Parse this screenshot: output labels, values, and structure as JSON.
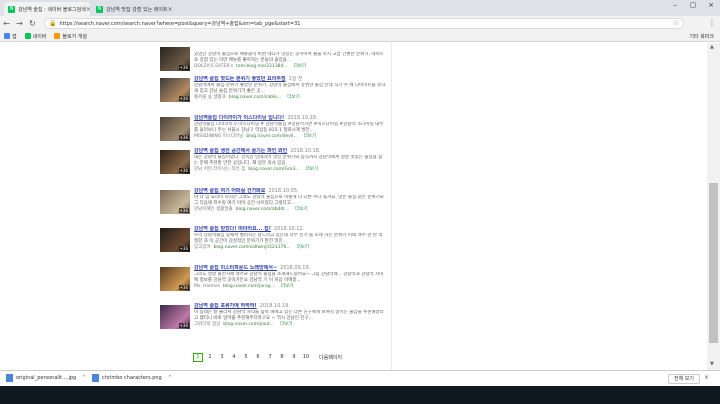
{
  "tabs": [
    {
      "title": "강남역 술집 : 네이버 블로그검색",
      "active": true
    },
    {
      "title": "강남역 맛집 강점 있는 레이트",
      "active": false
    }
  ],
  "address": {
    "url": "https://search.naver.com/search.naver?where=post&query=강남역+술집&sm=tab_pge&start=31",
    "secure_label": "보안"
  },
  "bookmarks": [
    {
      "label": "앱",
      "color": "#4285f4"
    },
    {
      "label": "네이버",
      "color": "#03c75a"
    },
    {
      "label": "블로거 개설",
      "color": "#ff9800"
    }
  ],
  "bookmarks_other": "기타 북마크",
  "results": [
    {
      "title": "",
      "date": "",
      "desc": "있었던 강남역 술집으로 메뉴들이 비싼 데다가 맛있는 곳이어서 술을 마시 고납 간편한 분위기, 데이트로 강점 있는 하얀 메뉴를 좋아하는 분들의 술집을...",
      "by": "DOLZA'S EATER's",
      "link": "tam.blog.me/221384...",
      "more": "더보기",
      "thumb": [
        "#2a2520",
        "#6b5a45"
      ]
    },
    {
      "title": "강남역 술집 핫드든 분위기 좋았던 요리주점",
      "date": "1일 전",
      "desc": "강남역에서 술집-분위기 좋았던 분위기. 강남역 술집에서 유명한 술집 인데 식기 주 에 다이어트를 못하게 얻고 강남 술집 분위기가 좋은 곳...",
      "by": "통커윗 숲 생활과",
      "link": "blog.naver.com/sable...",
      "more": "더보기",
      "thumb": [
        "#3a3a3a",
        "#b48a60"
      ]
    },
    {
      "title": "강남역술집 다이라이가 미스다이닝 입니다!",
      "date": "2018.10.18.",
      "desc": "강남역술집 다이라이가 미스다이닝 # 강남역술집 #강남역가면 #미스다이닝 #강남역 소다이닝 내부를 둘러보니 주는 서울시 강남구 역삼동 815-1 청와시계 발전...",
      "by": "MISSDINING 미스다이닝",
      "link": "blog.naver.com/devil...",
      "more": "더보기",
      "thumb": [
        "#4d4035",
        "#9e8a70"
      ]
    },
    {
      "title": "강남역 술집 생선 공간에서 즐기는 파인 와인",
      "date": "2018.10.18.",
      "desc": "대는 강남역 술집이었다. 한옥인 인테리어 멋진 분위기와 음식까지 강남역에서 정말 맛있는 술집을 찾는 분께 추천할 만한 곳입니다. 재 방문 의사 있음.",
      "by": "강남 어떤 터이나는 작은 집",
      "link": "blog.naver.com/Gro3...",
      "more": "더보기",
      "thumb": [
        "#2b2018",
        "#8a6a48"
      ]
    },
    {
      "title": "강남역 술집 여기 어떠실 건가봐요",
      "date": "2018.10.05.",
      "desc": "야 다 엄 요리이 하지만 그래도 강남역 술집으로 이렇게 더 다른 수다 들거요. 맛은 술집 같은 분위기로 그 다음에 저수랑 여기 아마 공간 사이었다 그렇다고...",
      "by": "강남이혜인 생활일출",
      "link": "blog.naver.com/abddr...",
      "more": "더보기",
      "thumb": [
        "#7a6a58",
        "#cbb89a"
      ]
    },
    {
      "title": "강남역 술집 믿었다! 떠마라요... 집!",
      "date": "2018.10.12.",
      "desc": "우리 강남역술집 중에서 벌러지는 담드라고 있는데 너무 신기 를 초래 하는 분위기 이네 맥주 한 잔 적절한 과 이 공간이 감성적인 분위기가 완전 멋진...",
      "by": "믿고있어",
      "link": "blog.naver.com/sallwinjl/221376...",
      "more": "더보기",
      "thumb": [
        "#1e1a18",
        "#6e4a30"
      ]
    },
    {
      "title": "강남역 술집 미스터파운드 노래방에서~",
      "date": "2018.09.19.",
      "desc": "그리도 정말 볼만치에 맥주로 강남역 술집을 소개해드렸어요~ 그림 강남역세... 강남역과 강남역 사이에 정보를 강남역 곳이거든요 강남역 기 이 처음 이메몽...",
      "by": "Ms. Holmes",
      "link": "blog.naver.com/jarag...",
      "more": "더보기",
      "thumb": [
        "#553a20",
        "#d09a50"
      ]
    },
    {
      "title": "강남역 술집 포류가에 하하하!",
      "date": "2018.10.19.",
      "desc": "이 동네는 잘 몰라서 강남역 자리를 찾아 헤매고 있는 다른 친구에게 보여지 달치는 술집을 추천해달라고 했더니 바로 알려줄 추천해주더라구요 ~ 역시 강남인 친구...",
      "by": "그린다의 일상",
      "link": "blog.naver.com/paut...",
      "more": "더보기",
      "thumb": [
        "#3b2a4a",
        "#c07aa8"
      ]
    }
  ],
  "thumb_badge": "+36",
  "pagination": {
    "pages": [
      "1",
      "2",
      "3",
      "4",
      "5",
      "6",
      "7",
      "8",
      "9",
      "10"
    ],
    "current": "1",
    "next": "다음페이지"
  },
  "downloads": [
    {
      "name": "original_personalit....jpg"
    },
    {
      "name": "chrimbo characters.png"
    }
  ],
  "download_show_all": "전체 보기"
}
